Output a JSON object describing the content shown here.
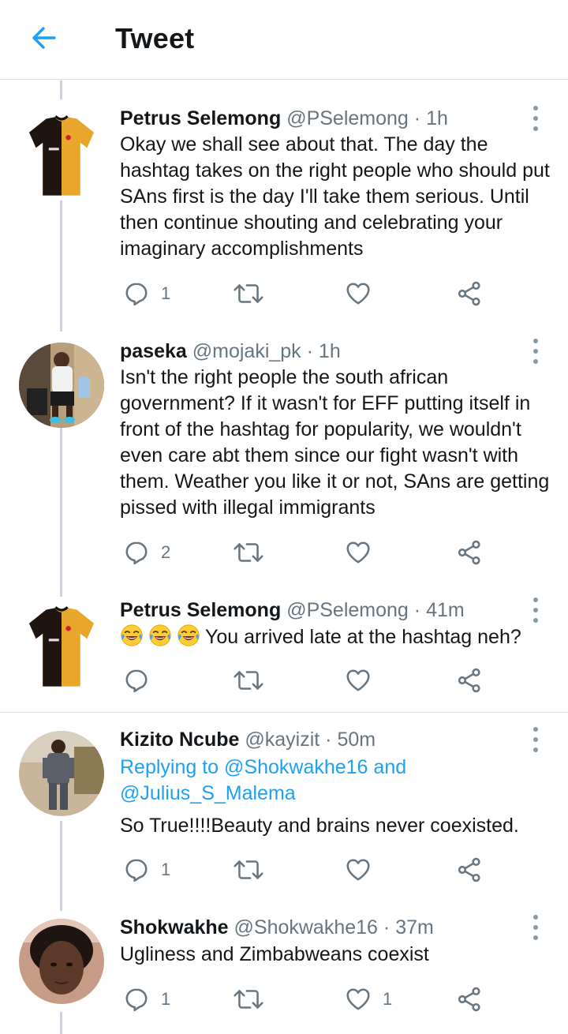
{
  "header": {
    "title": "Tweet"
  },
  "tweets": [
    {
      "name": "Petrus Selemong",
      "handle": "@PSelemong",
      "dot": "·",
      "time": "1h",
      "text": "Okay we shall see about that. The day the hashtag takes on the right people who should put SAns first is the day I'll take them serious. Until then continue shouting and celebrating your imaginary accomplishments",
      "reply_count": "1",
      "retweet_count": "",
      "like_count": ""
    },
    {
      "name": "paseka",
      "handle": "@mojaki_pk",
      "dot": "·",
      "time": "1h",
      "text": "Isn't the right people the south african government? If it wasn't for EFF putting itself in front of the hashtag for popularity, we wouldn't even care abt them since our fight wasn't with them. Weather you like it or not, SAns are getting pissed with illegal immigrants",
      "reply_count": "2",
      "retweet_count": "",
      "like_count": ""
    },
    {
      "name": "Petrus Selemong",
      "handle": "@PSelemong",
      "dot": "·",
      "time": "41m",
      "text": "You arrived late at the hashtag neh?",
      "emoji": "face-with-tears-of-joy",
      "reply_count": "",
      "retweet_count": "",
      "like_count": ""
    },
    {
      "name": "Kizito Ncube",
      "handle": "@kayizit",
      "dot": "·",
      "time": "50m",
      "replying_prefix": "Replying to ",
      "replying_link1": "@Shokwakhe16 and",
      "replying_link2": "@Julius_S_Malema",
      "text": "So True!!!!Beauty and brains never coexisted.",
      "reply_count": "1",
      "retweet_count": "",
      "like_count": ""
    },
    {
      "name": "Shokwakhe",
      "handle": "@Shokwakhe16",
      "dot": "·",
      "time": "37m",
      "text": "Ugliness and Zimbabweans coexist",
      "reply_count": "1",
      "retweet_count": "",
      "like_count": "1"
    }
  ],
  "colors": {
    "accent": "#1da1f2",
    "icon": "#66757f",
    "text": "#14171a",
    "muted": "#66757f",
    "divider": "#dcdfe2",
    "thread_line": "#cdd3d8"
  },
  "icons": {
    "back": "back-arrow-icon",
    "more": "more-vertical-icon",
    "reply": "reply-icon",
    "retweet": "retweet-icon",
    "like": "heart-icon",
    "share": "share-icon"
  }
}
